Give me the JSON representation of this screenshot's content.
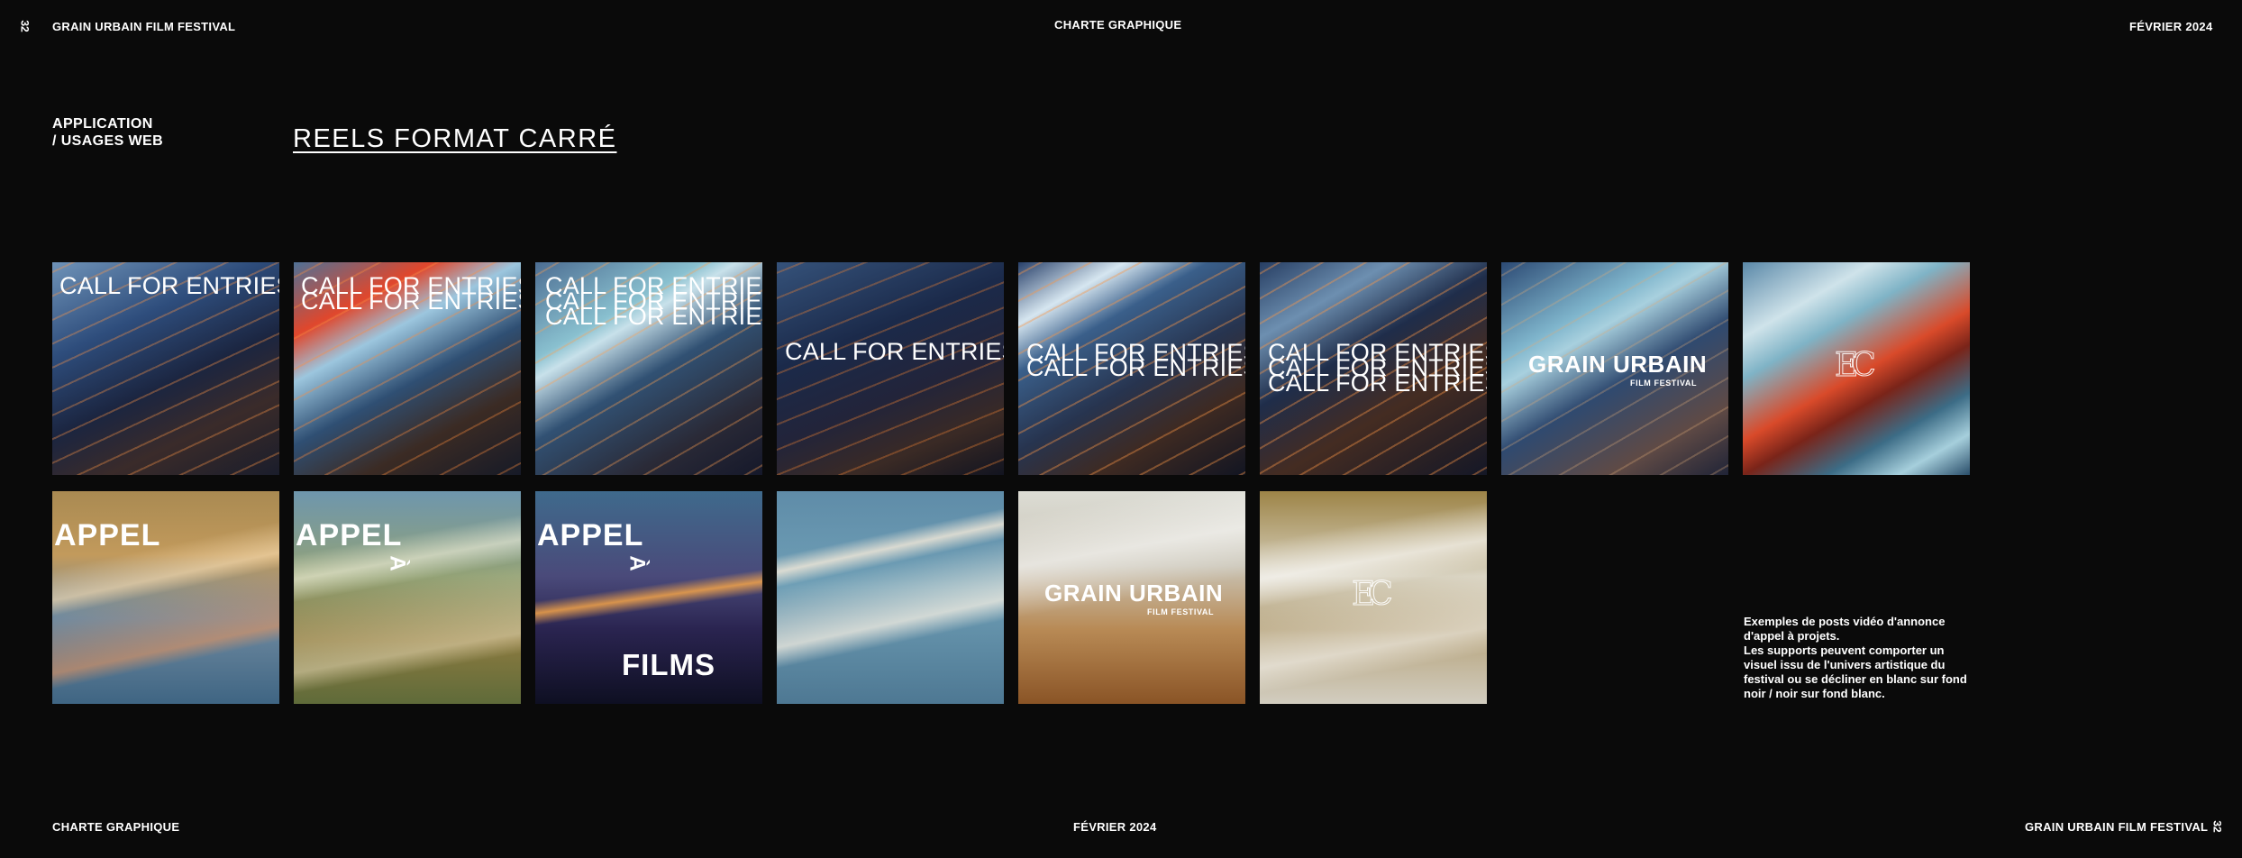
{
  "header": {
    "page_number": "32",
    "left": "GRAIN URBAIN FILM FESTIVAL",
    "center": "CHARTE GRAPHIQUE",
    "right": "FÉVRIER 2024"
  },
  "footer": {
    "left": "CHARTE GRAPHIQUE",
    "center": "FÉVRIER 2024",
    "right": "GRAIN URBAIN FILM FESTIVAL",
    "page_number": "32"
  },
  "section": {
    "label_line1": "APPLICATION",
    "label_line2": "/ USAGES WEB",
    "title": "REELS FORMAT CARRÉ"
  },
  "texts": {
    "call_for_entries": "CALL FOR ENTRIES",
    "appel": "APPEL",
    "a": "À",
    "films": "FILMS",
    "brand_name": "GRAIN URBAIN",
    "brand_sub": "FILM FESTIVAL",
    "monogram": "EC"
  },
  "caption": {
    "line1": "Exemples de posts vidéo d'annonce d'appel à projets.",
    "line2": "Les supports peuvent comporter un visuel issu de l'univers artistique du festival ou se décliner en blanc sur fond noir / noir sur fond blanc."
  }
}
